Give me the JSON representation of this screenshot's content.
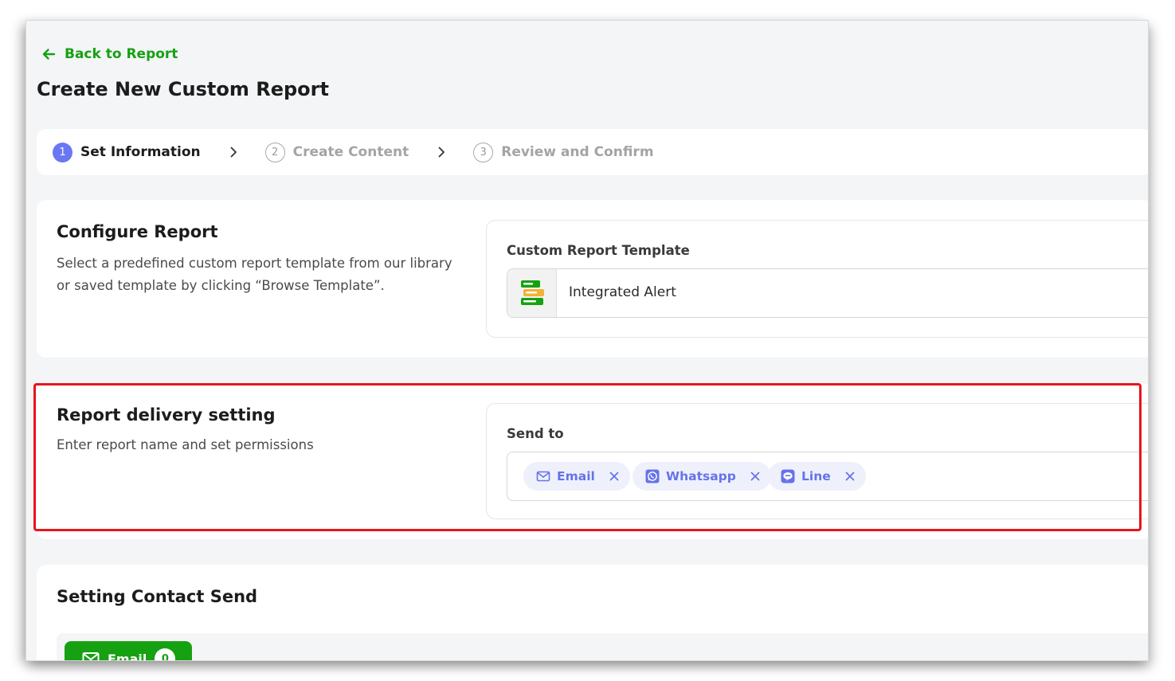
{
  "back_link": {
    "label": "Back to Report",
    "icon": "arrow-left-icon",
    "color": "#16a112"
  },
  "page_title": "Create New Custom Report",
  "stepper": {
    "steps": [
      {
        "number": "1",
        "label": "Set Information",
        "state": "active"
      },
      {
        "number": "2",
        "label": "Create Content",
        "state": "inactive"
      },
      {
        "number": "3",
        "label": "Review and Confirm",
        "state": "inactive"
      }
    ],
    "active_color": "#6a77f2"
  },
  "configure_report": {
    "title": "Configure Report",
    "description": "Select a predefined custom report template from our library or saved template by clicking “Browse Template”.",
    "template_label": "Custom Report Template",
    "template_value": "Integrated Alert",
    "template_icon": "stacked-layers-icon"
  },
  "delivery": {
    "title": "Report delivery setting",
    "description": "Enter report name and set permissions",
    "send_to_label": "Send to",
    "channels": [
      {
        "label": "Email",
        "icon": "mail-icon"
      },
      {
        "label": "Whatsapp",
        "icon": "whatsapp-icon"
      },
      {
        "label": "Line",
        "icon": "line-chat-icon"
      }
    ],
    "highlight_color": "#e8141f"
  },
  "contact_send": {
    "title": "Setting Contact Send",
    "tab_label": "Email",
    "tab_count": "0"
  }
}
